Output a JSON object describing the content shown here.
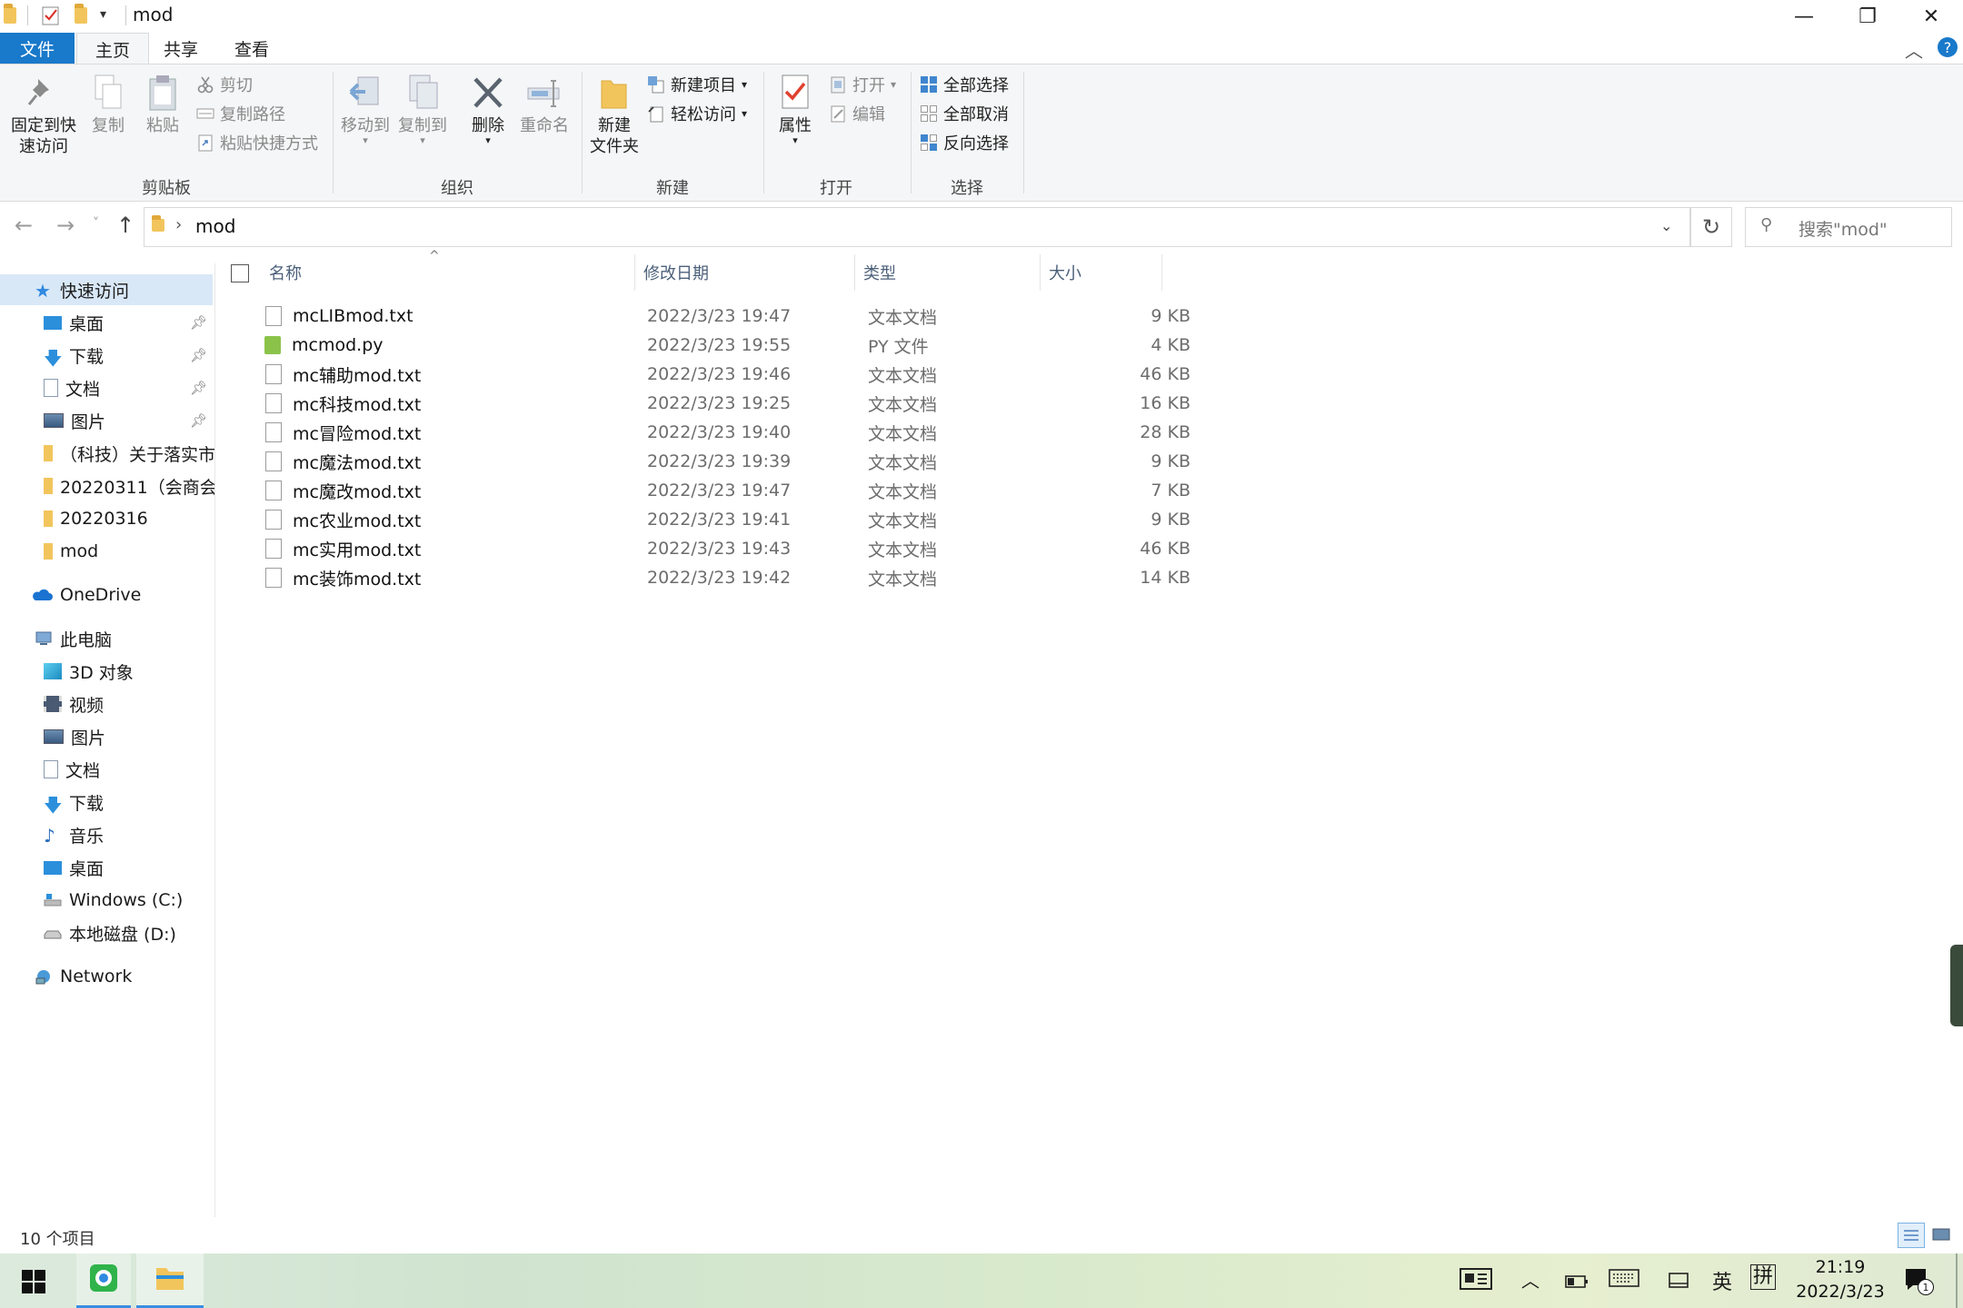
{
  "window": {
    "title": "mod",
    "minimize_glyph": "—",
    "restore_glyph": "❐",
    "close_glyph": "✕"
  },
  "tabs": [
    {
      "label": "文件"
    },
    {
      "label": "主页"
    },
    {
      "label": "共享"
    },
    {
      "label": "查看"
    }
  ],
  "ribbon": {
    "groups": {
      "clipboard": "剪贴板",
      "organize": "组织",
      "new": "新建",
      "open": "打开",
      "select": "选择"
    },
    "pin_line1": "固定到快",
    "pin_line2": "速访问",
    "copy": "复制",
    "paste": "粘贴",
    "cut": "剪切",
    "copy_path": "复制路径",
    "paste_shortcut": "粘贴快捷方式",
    "move_to": "移动到",
    "copy_to": "复制到",
    "delete": "删除",
    "rename": "重命名",
    "new_folder_line1": "新建",
    "new_folder_line2": "文件夹",
    "new_item": "新建项目",
    "easy_access": "轻松访问",
    "properties": "属性",
    "open": "打开",
    "edit": "编辑",
    "select_all": "全部选择",
    "select_none": "全部取消",
    "invert_selection": "反向选择"
  },
  "address": {
    "path": "mod",
    "search_placeholder": "搜索\"mod\""
  },
  "sidebar": {
    "quick_access": "快速访问",
    "quick_items": [
      {
        "label": "桌面",
        "pinned": true
      },
      {
        "label": "下载",
        "pinned": true
      },
      {
        "label": "文档",
        "pinned": true
      },
      {
        "label": "图片",
        "pinned": true
      },
      {
        "label": "（科技）关于落实市",
        "pinned": false
      },
      {
        "label": "20220311（会商会",
        "pinned": false
      },
      {
        "label": "20220316",
        "pinned": false
      },
      {
        "label": "mod",
        "pinned": false
      }
    ],
    "onedrive": "OneDrive",
    "this_pc": "此电脑",
    "pc_items": [
      {
        "label": "3D 对象"
      },
      {
        "label": "视频"
      },
      {
        "label": "图片"
      },
      {
        "label": "文档"
      },
      {
        "label": "下载"
      },
      {
        "label": "音乐"
      },
      {
        "label": "桌面"
      },
      {
        "label": "Windows (C:)"
      },
      {
        "label": "本地磁盘 (D:)"
      }
    ],
    "network": "Network"
  },
  "columns": {
    "name": "名称",
    "date": "修改日期",
    "type": "类型",
    "size": "大小"
  },
  "files": [
    {
      "name": "mcLIBmod.txt",
      "date": "2022/3/23 19:47",
      "type": "文本文档",
      "size": "9 KB",
      "icon": "text-file-icon"
    },
    {
      "name": "mcmod.py",
      "date": "2022/3/23 19:55",
      "type": "PY 文件",
      "size": "4 KB",
      "icon": "python-file-icon"
    },
    {
      "name": "mc辅助mod.txt",
      "date": "2022/3/23 19:46",
      "type": "文本文档",
      "size": "46 KB",
      "icon": "text-file-icon"
    },
    {
      "name": "mc科技mod.txt",
      "date": "2022/3/23 19:25",
      "type": "文本文档",
      "size": "16 KB",
      "icon": "text-file-icon"
    },
    {
      "name": "mc冒险mod.txt",
      "date": "2022/3/23 19:40",
      "type": "文本文档",
      "size": "28 KB",
      "icon": "text-file-icon"
    },
    {
      "name": "mc魔法mod.txt",
      "date": "2022/3/23 19:39",
      "type": "文本文档",
      "size": "9 KB",
      "icon": "text-file-icon"
    },
    {
      "name": "mc魔改mod.txt",
      "date": "2022/3/23 19:47",
      "type": "文本文档",
      "size": "7 KB",
      "icon": "text-file-icon"
    },
    {
      "name": "mc农业mod.txt",
      "date": "2022/3/23 19:41",
      "type": "文本文档",
      "size": "9 KB",
      "icon": "text-file-icon"
    },
    {
      "name": "mc实用mod.txt",
      "date": "2022/3/23 19:43",
      "type": "文本文档",
      "size": "46 KB",
      "icon": "text-file-icon"
    },
    {
      "name": "mc装饰mod.txt",
      "date": "2022/3/23 19:42",
      "type": "文本文档",
      "size": "14 KB",
      "icon": "text-file-icon"
    }
  ],
  "status": {
    "item_count": "10 个项目"
  },
  "taskbar": {
    "time": "21:19",
    "date": "2022/3/23",
    "ime_lang": "英",
    "ime_mode": "拼",
    "notification_count": "1"
  },
  "colors": {
    "accent": "#1979ca",
    "selection": "#d9e8f7",
    "folder": "#f2c55c"
  }
}
